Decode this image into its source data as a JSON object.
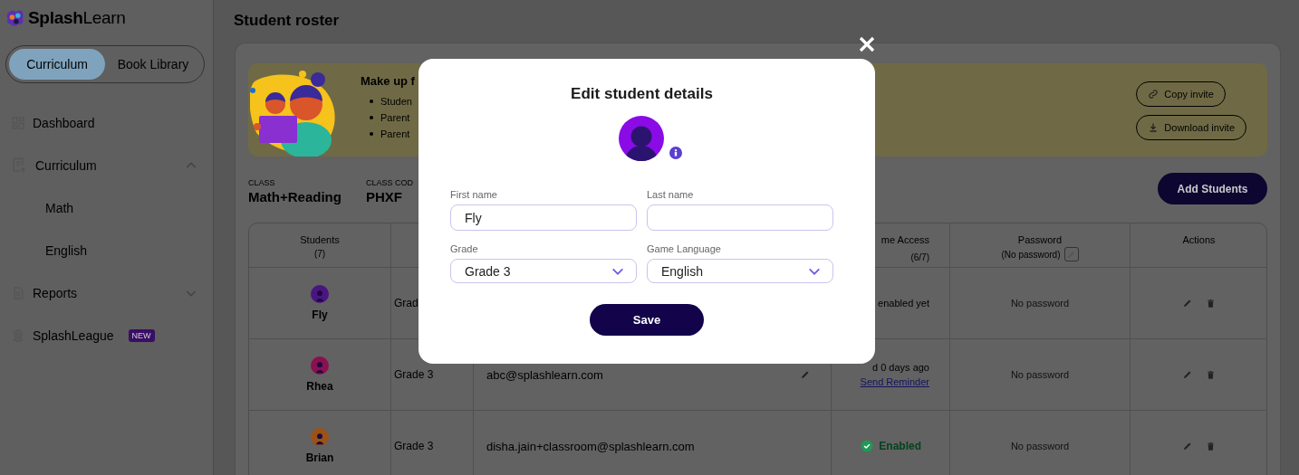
{
  "sidebar": {
    "logo": "**Splash**Learn",
    "toggle": [
      {
        "label": "Curriculum",
        "selected": true
      },
      {
        "label": "Book Library",
        "selected": false
      }
    ],
    "items": [
      {
        "label": "Dashboard",
        "kind": "dashboard"
      },
      {
        "label": "Curriculum",
        "kind": "curriculum",
        "expanded": true,
        "children": [
          {
            "label": "Math"
          },
          {
            "label": "English"
          }
        ]
      },
      {
        "label": "Reports",
        "kind": "reports",
        "expanded": false
      },
      {
        "label": "SplashLeague",
        "kind": "league",
        "badge": "NEW"
      }
    ]
  },
  "main": {
    "title": "Student roster",
    "banner": {
      "heading": "Make up f",
      "bullets": [
        "Studen",
        "Parent",
        "Parent"
      ],
      "buttons": [
        {
          "label": "Copy invite",
          "kind": "link"
        },
        {
          "label": "Download invite",
          "kind": "download"
        }
      ]
    },
    "class_info": [
      {
        "label": "CLASS",
        "value": "Math+Reading"
      },
      {
        "label": "CLASS COD",
        "value": "PHXF"
      }
    ],
    "add_button": "Add Students",
    "table": {
      "header": {
        "students": {
          "title": "Students",
          "subtitle": "(7)"
        },
        "access": {
          "title": "me Access",
          "subtitle": "(6/7)"
        },
        "password": {
          "title": "Password",
          "subtitle": "(No password)"
        },
        "actions": {
          "title": "Actions"
        }
      },
      "rows": [
        {
          "name": "Fly",
          "color": "#4a1580",
          "grade": "Grad",
          "access": {
            "text": "enabled yet"
          },
          "password": "No password"
        },
        {
          "name": "Rhea",
          "color": "#8a1050",
          "grade": "Grade 3",
          "email": "abc@splashlearn.com",
          "email_editable": true,
          "access": {
            "text": "d 0 days ago",
            "link": "Send Reminder"
          },
          "password": "No password"
        },
        {
          "name": "Brian",
          "color": "#9a5218",
          "grade": "Grade 3",
          "email": "disha.jain+classroom@splashlearn.com",
          "email_editable": false,
          "access": {
            "status": "Enabled"
          },
          "password": "No password"
        }
      ]
    }
  },
  "modal": {
    "title": "Edit student details",
    "fields": [
      {
        "label": "First name",
        "value": "Fly",
        "kind": "text"
      },
      {
        "label": "Last name",
        "kind": "text"
      },
      {
        "label": "Grade",
        "value": "Grade 3",
        "kind": "select"
      },
      {
        "label": "Game Language",
        "value": "English",
        "kind": "select"
      }
    ],
    "save": "Save"
  }
}
